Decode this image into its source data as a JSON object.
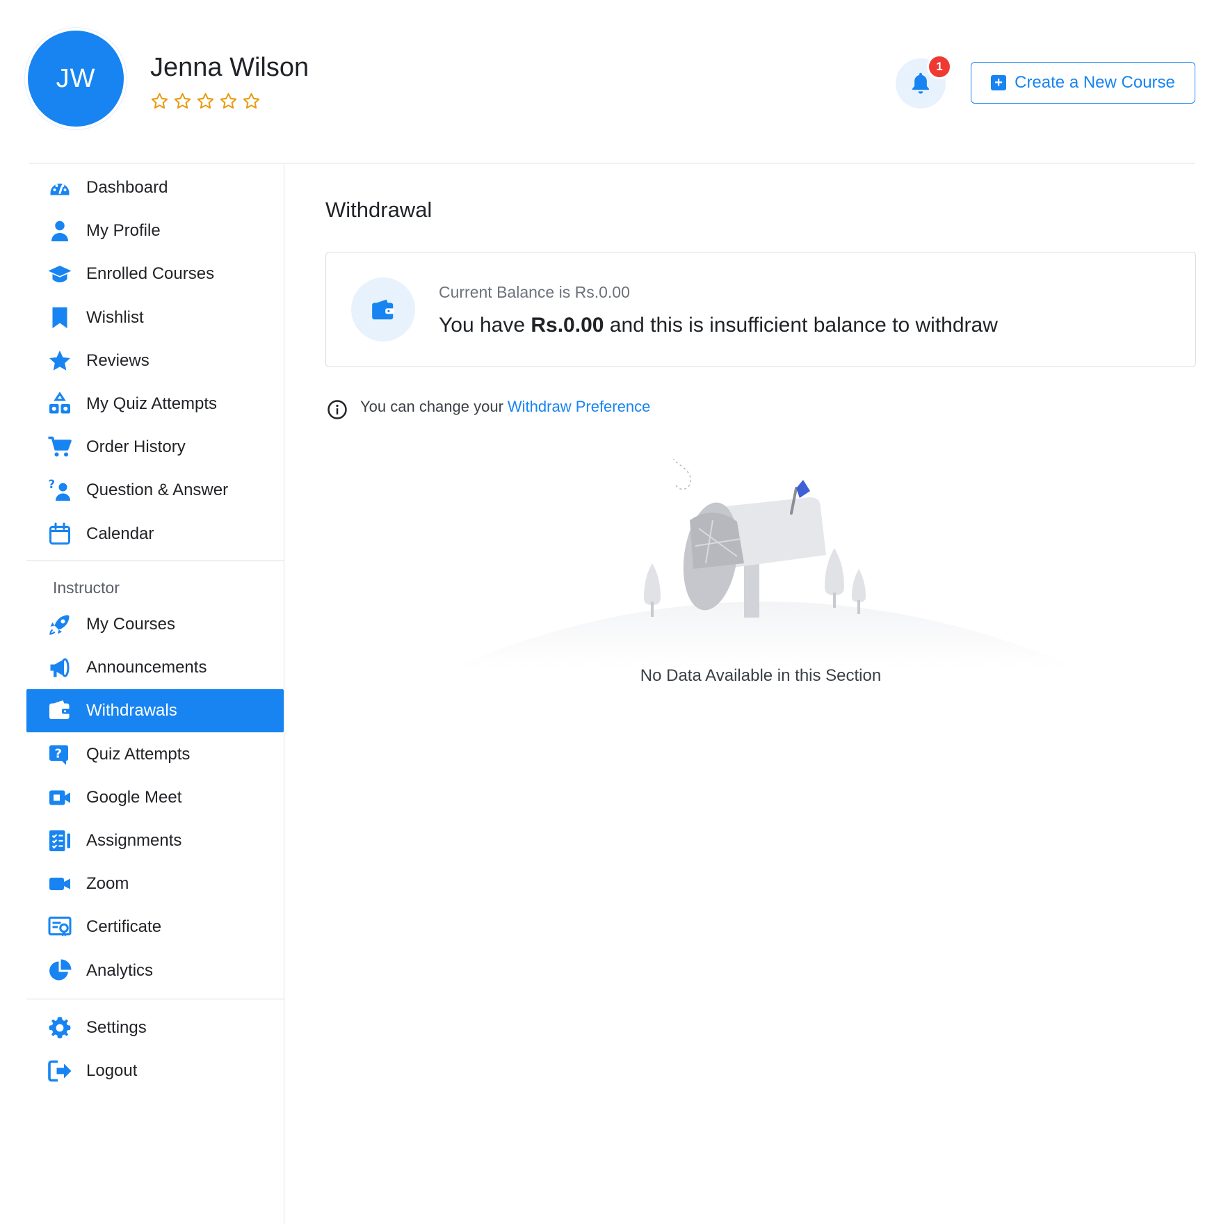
{
  "header": {
    "avatar_initials": "JW",
    "user_name": "Jenna Wilson",
    "rating_stars": 5,
    "rating_filled": 0,
    "notification_count": "1",
    "create_button_label": "Create a New Course",
    "accent_color": "#1784f2"
  },
  "sidebar": {
    "student_items": [
      {
        "label": "Dashboard",
        "icon": "dashboard-icon"
      },
      {
        "label": "My Profile",
        "icon": "user-icon"
      },
      {
        "label": "Enrolled Courses",
        "icon": "graduation-cap-icon"
      },
      {
        "label": "Wishlist",
        "icon": "bookmark-icon"
      },
      {
        "label": "Reviews",
        "icon": "star-icon"
      },
      {
        "label": "My Quiz Attempts",
        "icon": "shapes-icon"
      },
      {
        "label": "Order History",
        "icon": "cart-icon"
      },
      {
        "label": "Question & Answer",
        "icon": "question-person-icon"
      },
      {
        "label": "Calendar",
        "icon": "calendar-icon"
      }
    ],
    "section_label": "Instructor",
    "instructor_items": [
      {
        "label": "My Courses",
        "icon": "rocket-icon"
      },
      {
        "label": "Announcements",
        "icon": "megaphone-icon"
      },
      {
        "label": "Withdrawals",
        "icon": "wallet-icon",
        "active": true
      },
      {
        "label": "Quiz Attempts",
        "icon": "question-box-icon"
      },
      {
        "label": "Google Meet",
        "icon": "video-camera-icon"
      },
      {
        "label": "Assignments",
        "icon": "checklist-icon"
      },
      {
        "label": "Zoom",
        "icon": "zoom-camera-icon"
      },
      {
        "label": "Certificate",
        "icon": "certificate-icon"
      },
      {
        "label": "Analytics",
        "icon": "pie-chart-icon"
      }
    ],
    "bottom_items": [
      {
        "label": "Settings",
        "icon": "gear-icon"
      },
      {
        "label": "Logout",
        "icon": "logout-icon"
      }
    ]
  },
  "main": {
    "title": "Withdrawal",
    "balance_label": "Current Balance is Rs.0.00",
    "balance_msg_prefix": "You have ",
    "balance_amount": "Rs.0.00",
    "balance_msg_suffix": " and this is insufficient balance to withdraw",
    "info_text": "You can change your",
    "info_link": "Withdraw Preference",
    "empty_text": "No Data Available in this Section"
  }
}
